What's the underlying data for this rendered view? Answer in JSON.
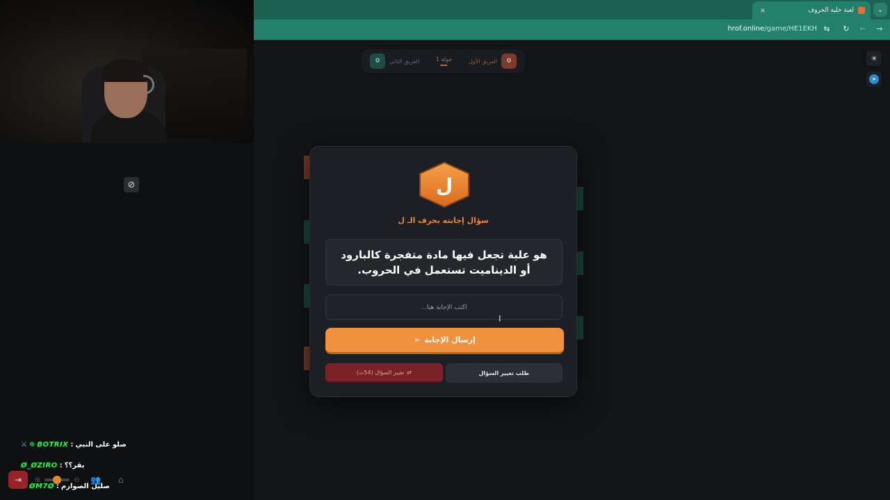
{
  "chat": {
    "messages": [
      {
        "user": "BOTRIX",
        "separator": ":",
        "text": "صلو على النبي"
      },
      {
        "user": "Ø_ØZIRO",
        "separator": ":",
        "text": "بقر؟؟"
      },
      {
        "user": "ØM7Ø",
        "separator": ":",
        "text": "صليل الصوارم"
      }
    ]
  },
  "browser": {
    "tab_title": "لعبة خلية الحروف",
    "tab_close": "×",
    "new_tab": "+",
    "url_host": "hrof.online",
    "url_path": "/game/HE1EKH"
  },
  "scoreboard": {
    "team1_name": "الفريق الأول",
    "team1_score": "0",
    "round_label": "جولة 1",
    "team2_name": "الفريق الثاني",
    "team2_score": "0"
  },
  "modal": {
    "letter": "ل",
    "question_type": "سؤال إجابته بحرف الـ ل",
    "question_text": "هو علبة تجعل فيها مادة متفجرة كالبارود أو الديناميت تستعمل في الحروب.",
    "answer_placeholder": "اكتب الإجابة هنا...",
    "submit_label": "إرسال الإجابة",
    "change_question_label": "تغيير السؤال (54ث)",
    "request_change_label": "طلب تغيير السؤال"
  },
  "colors": {
    "accent_orange": "#f0913e",
    "browser_teal": "#22806b",
    "danger_red": "#7a2228"
  }
}
